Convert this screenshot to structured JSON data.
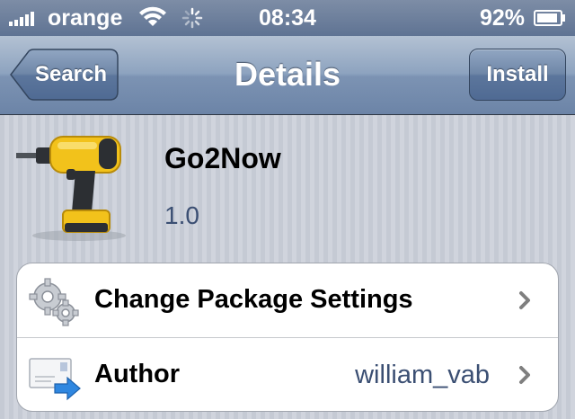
{
  "status_bar": {
    "carrier": "orange",
    "time": "08:34",
    "battery_percent": "92%",
    "signal_bars": 5,
    "battery_level": 0.92,
    "icons": [
      "signal-bars-icon",
      "wifi-icon",
      "activity-spinner-icon",
      "battery-icon"
    ]
  },
  "nav": {
    "back_label": "Search",
    "title": "Details",
    "install_label": "Install"
  },
  "package": {
    "name": "Go2Now",
    "version": "1.0",
    "icon": "power-drill-icon"
  },
  "rows": [
    {
      "label": "Change Package Settings",
      "value": "",
      "icon": "gears-icon"
    },
    {
      "label": "Author",
      "value": "william_vab",
      "icon": "mail-forward-icon"
    }
  ],
  "colors": {
    "nav_tint": "#6c84a7",
    "status_bar": "#6c7f9c",
    "value_text": "#3b4f73",
    "drill_yellow": "#f2c21b"
  }
}
